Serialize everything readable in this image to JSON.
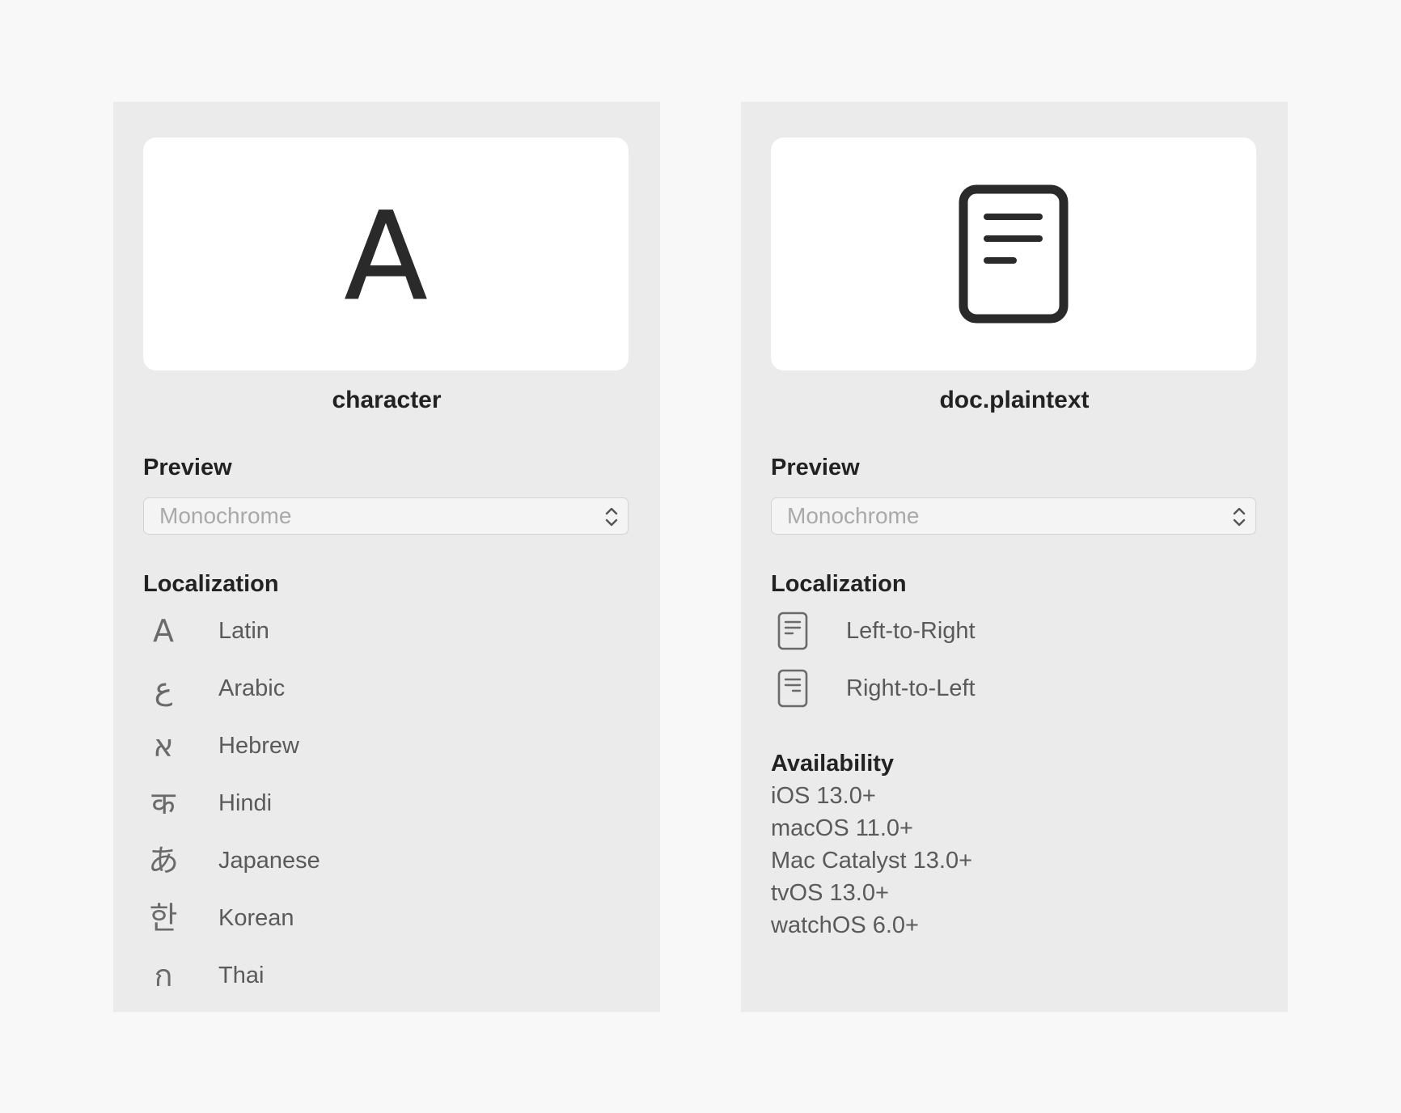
{
  "left": {
    "symbol_glyph": "A",
    "symbol_name": "character",
    "preview": {
      "title": "Preview",
      "select_value": "Monochrome"
    },
    "localization": {
      "title": "Localization",
      "items": [
        {
          "glyph": "A",
          "label": "Latin"
        },
        {
          "glyph": "ع",
          "label": "Arabic"
        },
        {
          "glyph": "א",
          "label": "Hebrew"
        },
        {
          "glyph": "क",
          "label": "Hindi"
        },
        {
          "glyph": "あ",
          "label": "Japanese"
        },
        {
          "glyph": "한",
          "label": "Korean"
        },
        {
          "glyph": "ก",
          "label": "Thai"
        }
      ]
    }
  },
  "right": {
    "symbol_icon": "doc-plaintext-icon",
    "symbol_name": "doc.plaintext",
    "preview": {
      "title": "Preview",
      "select_value": "Monochrome"
    },
    "localization": {
      "title": "Localization",
      "items": [
        {
          "icon": "doc-plaintext-ltr-icon",
          "label": "Left-to-Right"
        },
        {
          "icon": "doc-plaintext-rtl-icon",
          "label": "Right-to-Left"
        }
      ]
    },
    "availability": {
      "title": "Availability",
      "items": [
        "iOS 13.0+",
        "macOS 11.0+",
        "Mac Catalyst 13.0+",
        "tvOS 13.0+",
        "watchOS 6.0+"
      ]
    }
  }
}
